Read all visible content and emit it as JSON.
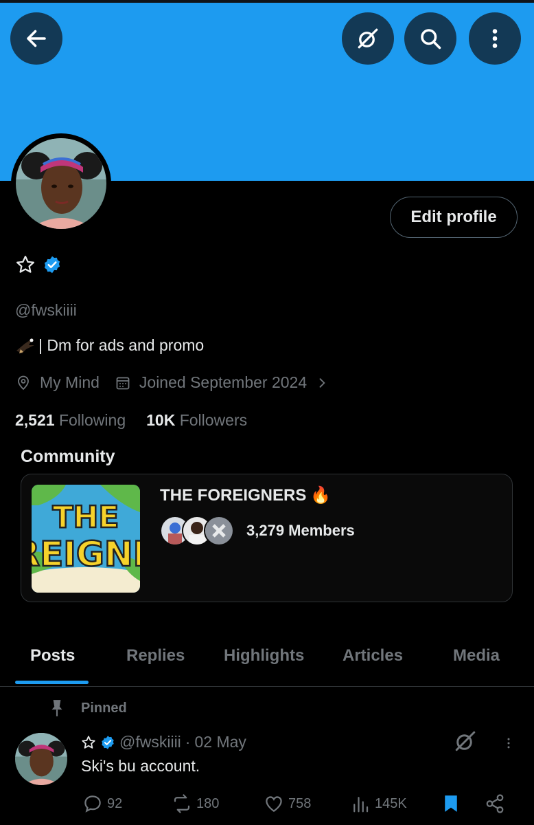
{
  "header": {
    "back_icon": "arrow-left-icon",
    "grok_icon": "grok-slash-icon",
    "search_icon": "search-icon",
    "more_icon": "more-vertical-icon",
    "banner_color": "#1d9bf0"
  },
  "profile": {
    "display_name_icon": "star-outline-icon",
    "verified_icon": "verified-badge-icon",
    "handle": "@fwskiiii",
    "bio": "| Dm for ads and promo",
    "location": "My Mind",
    "joined": "Joined September 2024",
    "edit_button": "Edit profile",
    "following_count": "2,521",
    "following_label": "Following",
    "followers_count": "10K",
    "followers_label": "Followers"
  },
  "community": {
    "section_title": "Community",
    "name": "THE FOREIGNERS",
    "emoji": "🔥",
    "members": "3,279 Members",
    "image_text_line1": "THE",
    "image_text_line2": "REIGNI"
  },
  "tabs": [
    {
      "label": "Posts",
      "active": true
    },
    {
      "label": "Replies",
      "active": false
    },
    {
      "label": "Highlights",
      "active": false
    },
    {
      "label": "Articles",
      "active": false
    },
    {
      "label": "Media",
      "active": false
    }
  ],
  "post": {
    "pinned_label": "Pinned",
    "handle": "@fwskiiii",
    "separator": "·",
    "date": "02 May",
    "text": "Ski's bu account.",
    "replies": "92",
    "reposts": "180",
    "likes": "758",
    "views": "145K"
  },
  "colors": {
    "accent": "#1d9bf0",
    "muted": "#71767b",
    "text": "#e7e9ea",
    "background": "#000000"
  }
}
